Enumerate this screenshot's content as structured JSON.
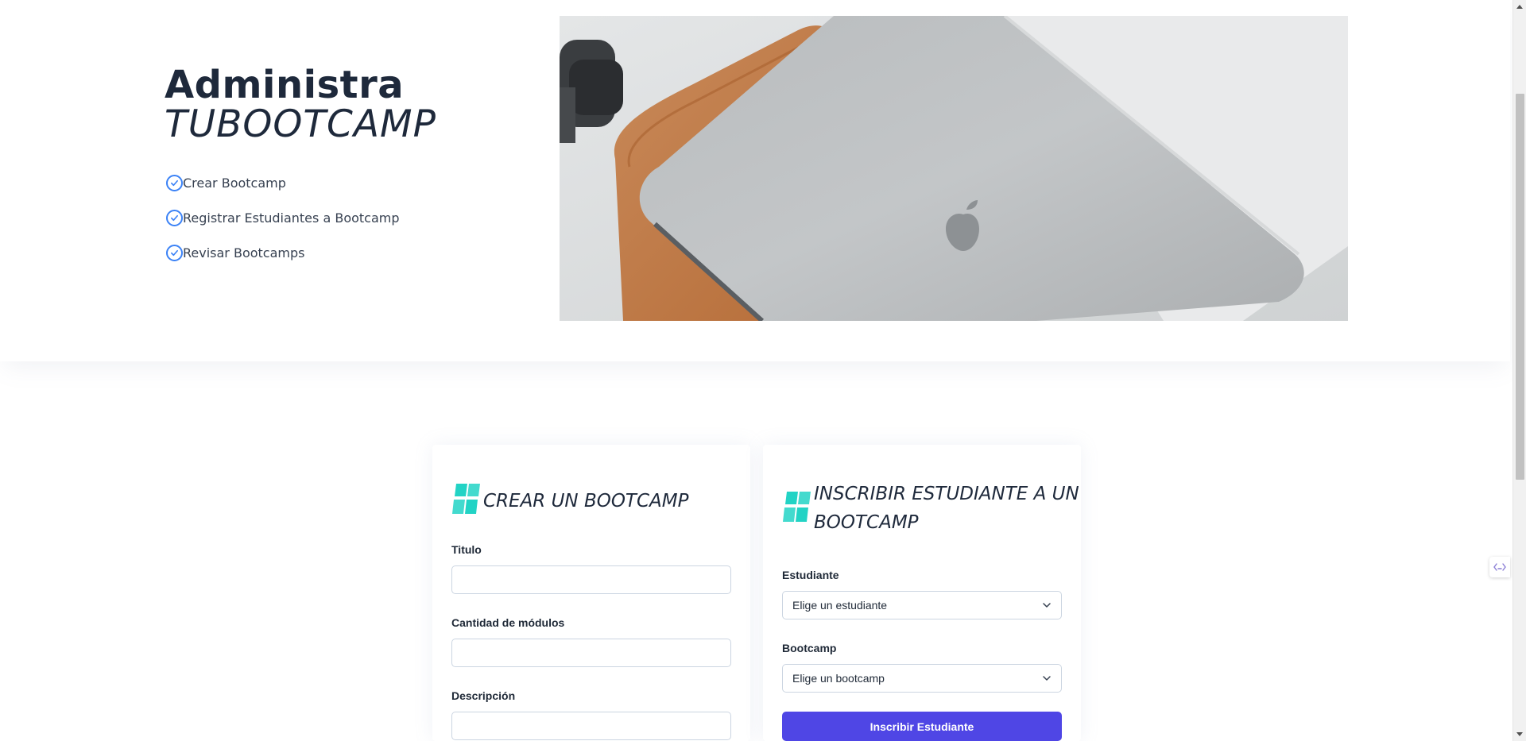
{
  "hero": {
    "title": "Administra",
    "brand": "TUBOOTCAMP",
    "features": [
      "Crear Bootcamp",
      "Registrar Estudiantes a Bootcamp",
      "Revisar Bootcamps"
    ]
  },
  "create_card": {
    "title": "CREAR UN BOOTCAMP",
    "fields": [
      {
        "label": "Titulo",
        "value": ""
      },
      {
        "label": "Cantidad de módulos",
        "value": ""
      },
      {
        "label": "Descripción",
        "value": ""
      }
    ]
  },
  "enroll_card": {
    "title_line1": "INSCRIBIR ESTUDIANTE A UN",
    "title_line2": "BOOTCAMP",
    "student_label": "Estudiante",
    "student_selected": "Elige un estudiante",
    "bootcamp_label": "Bootcamp",
    "bootcamp_selected": "Elige un bootcamp",
    "submit_label": "Inscribir Estudiante"
  },
  "colors": {
    "accent": "#4f46e5",
    "check": "#3b82f6",
    "logo": "#22d3c5",
    "heading": "#1e293b"
  },
  "icons": [
    "check-circle-icon",
    "laptop-photo",
    "bootcamp-logo-icon",
    "chevron-down-icon",
    "code-widget-icon"
  ]
}
